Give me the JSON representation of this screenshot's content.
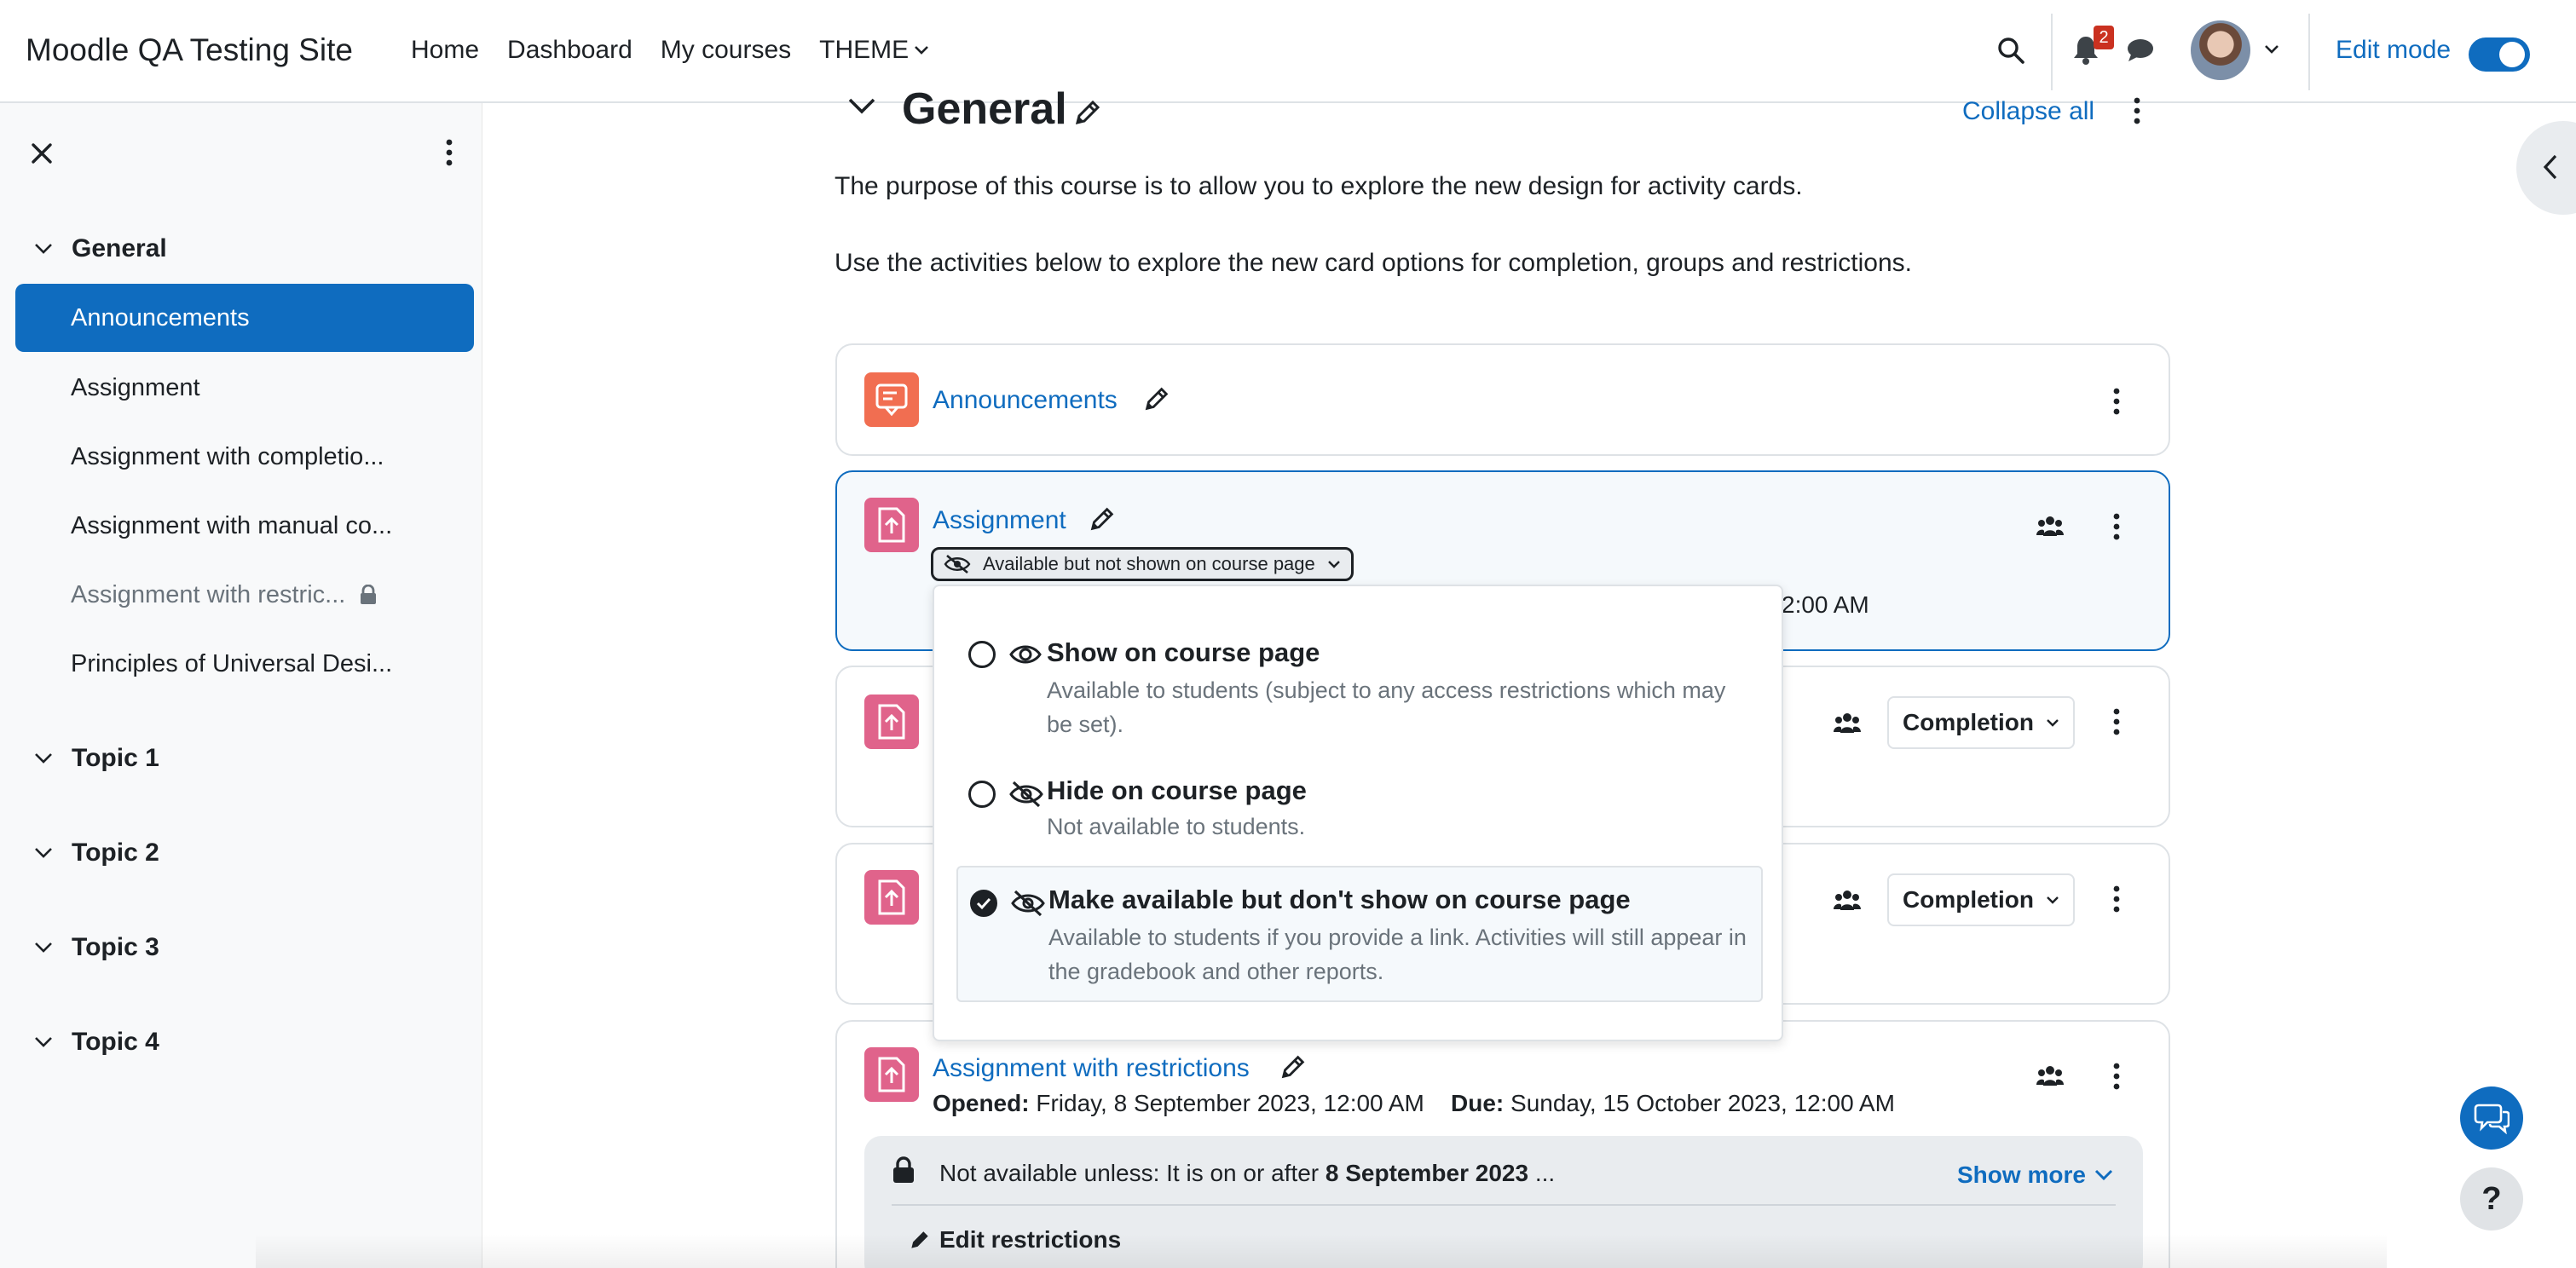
{
  "navbar": {
    "brand": "Moodle QA Testing Site",
    "links": [
      "Home",
      "Dashboard",
      "My courses",
      "THEME"
    ],
    "notification_count": "2",
    "edit_mode_label": "Edit mode"
  },
  "drawer": {
    "sections": {
      "general": "General",
      "topics": [
        "Topic 1",
        "Topic 2",
        "Topic 3",
        "Topic 4"
      ]
    },
    "items": [
      "Announcements",
      "Assignment",
      "Assignment with completio...",
      "Assignment with manual co...",
      "Assignment with restric...",
      "Principles of Universal Desi..."
    ]
  },
  "section": {
    "title": "General",
    "collapse_all": "Collapse all",
    "summary": [
      "The purpose of this course is to allow you to explore the new design for activity cards.",
      "Use the activities below to explore the new card options for completion, groups and restrictions."
    ]
  },
  "activities": {
    "announcements": {
      "name": "Announcements"
    },
    "assignment": {
      "name": "Assignment",
      "visibility_badge": "Available but not shown on course page",
      "date_fragment": "2:00 AM"
    },
    "completion_label": "Completion",
    "restricted": {
      "name": "Assignment with restrictions",
      "opened_label": "Opened:",
      "opened_value": "Friday, 8 September 2023, 12:00 AM",
      "due_label": "Due:",
      "due_value": "Sunday, 15 October 2023, 12:00 AM",
      "restriction_prefix": "Not available unless: It is on or after",
      "restriction_date": "8 September 2023",
      "restriction_suffix": "...",
      "show_more": "Show more",
      "edit_restrictions": "Edit restrictions"
    }
  },
  "visibility_dropdown": {
    "options": [
      {
        "title": "Show on course page",
        "desc": "Available to students (subject to any access restrictions which may be set).",
        "icon": "eye-icon",
        "checked": false
      },
      {
        "title": "Hide on course page",
        "desc": "Not available to students.",
        "icon": "eye-slash-icon",
        "checked": false
      },
      {
        "title": "Make available but don't show on course page",
        "desc": "Available to students if you provide a link. Activities will still appear in the gradebook and other reports.",
        "icon": "eye-slash-icon",
        "checked": true
      }
    ]
  },
  "fab": {
    "help": "?"
  },
  "colors": {
    "primary": "#0f6cbf",
    "forum_icon": "#f16e51",
    "assign_icon": "#e0638b",
    "badge_red": "#ca3120"
  }
}
